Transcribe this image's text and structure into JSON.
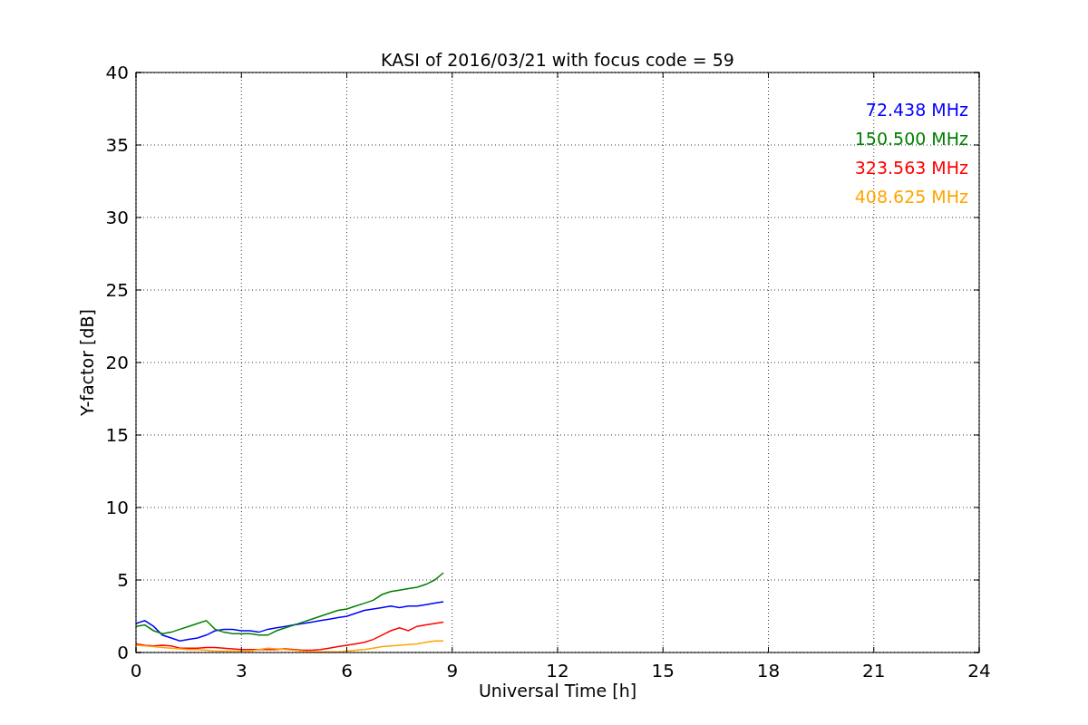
{
  "chart_data": {
    "type": "line",
    "title": "KASI of 2016/03/21 with focus code = 59",
    "xlabel": "Universal Time [h]",
    "ylabel": "Y-factor [dB]",
    "x": [
      0,
      0.25,
      0.5,
      0.75,
      1,
      1.25,
      1.5,
      1.75,
      2,
      2.25,
      2.5,
      2.75,
      3,
      3.25,
      3.5,
      3.75,
      4,
      4.25,
      4.5,
      4.75,
      5,
      5.25,
      5.5,
      5.75,
      6,
      6.25,
      6.5,
      6.75,
      7,
      7.25,
      7.5,
      7.75,
      8,
      8.25,
      8.5,
      8.75
    ],
    "series": [
      {
        "name": "72.438 MHz",
        "color": "#0000ff",
        "values": [
          2.0,
          2.2,
          1.8,
          1.2,
          1.0,
          0.8,
          0.9,
          1.0,
          1.2,
          1.5,
          1.6,
          1.6,
          1.5,
          1.5,
          1.4,
          1.6,
          1.7,
          1.8,
          1.9,
          2.0,
          2.1,
          2.2,
          2.3,
          2.4,
          2.5,
          2.7,
          2.9,
          3.0,
          3.1,
          3.2,
          3.1,
          3.2,
          3.2,
          3.3,
          3.4,
          3.5
        ]
      },
      {
        "name": "150.500 MHz",
        "color": "#008000",
        "values": [
          1.8,
          1.9,
          1.5,
          1.3,
          1.4,
          1.6,
          1.8,
          2.0,
          2.2,
          1.6,
          1.4,
          1.3,
          1.3,
          1.3,
          1.2,
          1.2,
          1.5,
          1.7,
          1.9,
          2.1,
          2.3,
          2.5,
          2.7,
          2.9,
          3.0,
          3.2,
          3.4,
          3.6,
          4.0,
          4.2,
          4.3,
          4.4,
          4.5,
          4.7,
          5.0,
          5.5
        ]
      },
      {
        "name": "323.563 MHz",
        "color": "#ff0000",
        "values": [
          0.6,
          0.5,
          0.45,
          0.5,
          0.45,
          0.3,
          0.3,
          0.3,
          0.35,
          0.35,
          0.3,
          0.25,
          0.2,
          0.2,
          0.2,
          0.2,
          0.2,
          0.25,
          0.2,
          0.15,
          0.15,
          0.2,
          0.3,
          0.4,
          0.5,
          0.6,
          0.7,
          0.9,
          1.2,
          1.5,
          1.7,
          1.5,
          1.8,
          1.9,
          2.0,
          2.1
        ]
      },
      {
        "name": "408.625 MHz",
        "color": "#ffa500",
        "values": [
          0.5,
          0.45,
          0.4,
          0.35,
          0.3,
          0.25,
          0.2,
          0.2,
          0.15,
          0.1,
          0.1,
          0.1,
          0.1,
          0.1,
          0.2,
          0.3,
          0.25,
          0.2,
          0.15,
          0.1,
          0.05,
          0.05,
          0.05,
          0.05,
          0.1,
          0.15,
          0.2,
          0.3,
          0.4,
          0.45,
          0.5,
          0.55,
          0.6,
          0.7,
          0.8,
          0.8
        ]
      }
    ],
    "grid": true,
    "xlim": [
      0,
      24
    ],
    "ylim": [
      0,
      40
    ],
    "xticks": [
      0,
      3,
      6,
      9,
      12,
      15,
      18,
      21,
      24
    ],
    "yticks": [
      0,
      5,
      10,
      15,
      20,
      25,
      30,
      35,
      40
    ]
  }
}
